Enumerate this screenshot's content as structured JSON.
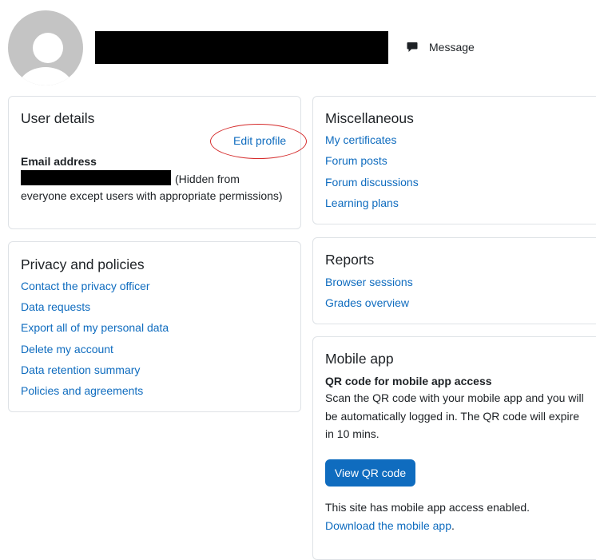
{
  "header": {
    "message_label": "Message",
    "message_icon": "speech-bubble-icon"
  },
  "user_details": {
    "title": "User details",
    "edit_profile": "Edit profile",
    "email_label": "Email address",
    "email_note_1": "(Hidden from",
    "email_note_2": "everyone except users with appropriate permissions)"
  },
  "privacy": {
    "title": "Privacy and policies",
    "links": [
      "Contact the privacy officer",
      "Data requests",
      "Export all of my personal data",
      "Delete my account",
      "Data retention summary",
      "Policies and agreements"
    ]
  },
  "misc": {
    "title": "Miscellaneous",
    "links": [
      "My certificates",
      "Forum posts",
      "Forum discussions",
      "Learning plans"
    ]
  },
  "reports": {
    "title": "Reports",
    "links": [
      "Browser sessions",
      "Grades overview"
    ]
  },
  "mobile": {
    "title": "Mobile app",
    "qr_heading": "QR code for mobile app access",
    "qr_desc_1": "Scan the QR code with your mobile app and you will",
    "qr_desc_2": "be automatically logged in. The QR code will expire",
    "qr_desc_3": "in 10 mins.",
    "qr_button": "View QR code",
    "enabled_text": "This site has mobile app access enabled.",
    "download_link": "Download the mobile app",
    "download_suffix": "."
  },
  "colors": {
    "link": "#0f6cbf",
    "primary_button": "#0f6cbf",
    "annotation_circle": "#d52b2b",
    "card_border": "#dee2e6",
    "avatar": "#c4c4c4"
  }
}
